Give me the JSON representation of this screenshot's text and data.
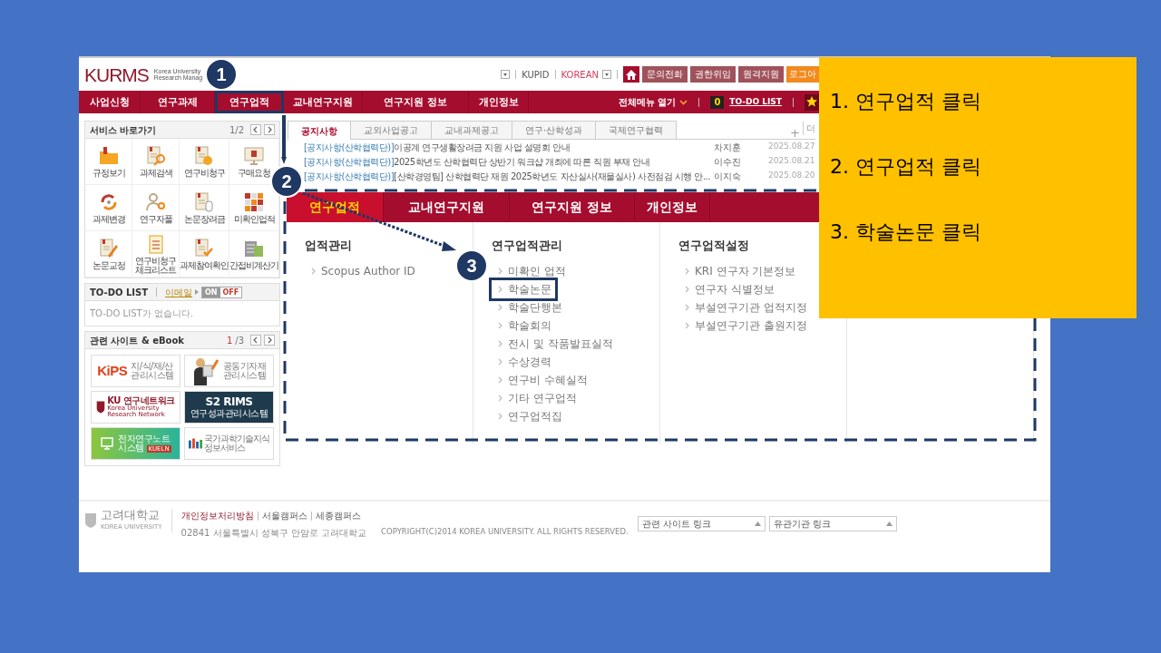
{
  "header": {
    "logo": "KURMS",
    "logo_subtitle": [
      "Korea University",
      "Research Manag"
    ],
    "links": [
      {
        "label": "KUPID",
        "emphasis": false
      },
      {
        "label": "KOREAN",
        "emphasis": true
      }
    ],
    "buttons": [
      {
        "label": "문의전화",
        "kind": "plain"
      },
      {
        "label": "권한위임",
        "kind": "plain"
      },
      {
        "label": "원격지원",
        "kind": "plain"
      },
      {
        "label": "로그아",
        "kind": "accent"
      }
    ]
  },
  "nav": {
    "items": [
      {
        "label": "사업신청",
        "selected": false,
        "annotated": false
      },
      {
        "label": "연구과제",
        "selected": false,
        "annotated": false
      },
      {
        "label": "연구업적",
        "selected": false,
        "annotated": true
      },
      {
        "label": "교내연구지원",
        "selected": false,
        "annotated": false
      },
      {
        "label": "연구지원 정보",
        "selected": false,
        "annotated": false
      },
      {
        "label": "개인정보",
        "selected": false,
        "annotated": false
      }
    ],
    "all_menu": "전체메뉴 열기",
    "todo_count": "0",
    "todo_label": "TO-DO LIST"
  },
  "shortcuts": {
    "title": "서비스 바로가기",
    "page": "1/2",
    "items": [
      "규정보기",
      "과제검색",
      "연구비청구",
      "구매요청",
      "과제변경",
      "연구자풀",
      "논문장려금",
      "미확인업적",
      "논문교정",
      "연구비청구 체크리스트",
      "과제참여확인",
      "간접비계산기"
    ]
  },
  "todo": {
    "title": "TO-DO LIST",
    "email": "이메일",
    "toggle": {
      "on_label": "ON",
      "off_label": "OFF",
      "on": false
    },
    "message": "TO-DO LIST가 없습니다."
  },
  "related": {
    "title": "관련 사이트 & eBook",
    "page": "1",
    "page_of": "/3",
    "banners": [
      {
        "kind": "kips",
        "logo": "KiPS",
        "lines": [
          "지/식/재/산",
          "관리시스템"
        ]
      },
      {
        "kind": "figure",
        "lines": [
          "공동기자재",
          "관리시스템"
        ]
      },
      {
        "kind": "crest",
        "logo": "KU 연구네트워크",
        "lines": [
          "Korea University Research Network"
        ]
      },
      {
        "kind": "dark",
        "logo": "S2 RIMS",
        "lines": [
          "연구성과관리시스템"
        ]
      },
      {
        "kind": "green",
        "lines": [
          "전자연구노트",
          "시스템"
        ],
        "tag": "KUELN"
      },
      {
        "kind": "bars",
        "lines": [
          "국가과학기술지식",
          "정보서비스"
        ]
      }
    ]
  },
  "notices": {
    "tabs": [
      {
        "label": "공지사항",
        "selected": true
      },
      {
        "label": "교외사업공고",
        "selected": false
      },
      {
        "label": "교내과제공고",
        "selected": false
      },
      {
        "label": "연구·산학성과",
        "selected": false
      },
      {
        "label": "국제연구협력",
        "selected": false
      }
    ],
    "plus": "+",
    "more": "더",
    "rows": [
      {
        "category": "[공지사항(산학협력단)]",
        "title": "이공계 연구생활장려금 지원 사업 설명회 안내",
        "author": "차지훈",
        "date": "2025.08.27"
      },
      {
        "category": "[공지사항(산학협력단)]",
        "title": "2025학년도 산학협력단 상반기 워크샵 개최에 따른 직원 부재 안내",
        "author": "이수진",
        "date": "2025.08.21"
      },
      {
        "category": "[공지사항(산학협력단)]",
        "title": "[산학경영팀] 산학협력단 재원 2025학년도 자산실사(재물실사) 사전점검 시행 안...",
        "author": "이지숙",
        "date": "2025.08.20"
      }
    ]
  },
  "menu": {
    "tabs": [
      {
        "label": "연구업적",
        "selected": true
      },
      {
        "label": "교내연구지원",
        "selected": false
      },
      {
        "label": "연구지원 정보",
        "selected": false
      },
      {
        "label": "개인정보",
        "selected": false
      }
    ],
    "columns": [
      {
        "heading": "업적관리",
        "items": [
          {
            "label": "Scopus Author ID",
            "annotated": false
          }
        ]
      },
      {
        "heading": "연구업적관리",
        "items": [
          {
            "label": "미확인 업적",
            "annotated": false
          },
          {
            "label": "학술논문",
            "annotated": true
          },
          {
            "label": "학술단행본",
            "annotated": false
          },
          {
            "label": "학술회의",
            "annotated": false
          },
          {
            "label": "전시 및 작품발표실적",
            "annotated": false
          },
          {
            "label": "수상경력",
            "annotated": false
          },
          {
            "label": "연구비 수혜실적",
            "annotated": false
          },
          {
            "label": "기타 연구업적",
            "annotated": false
          },
          {
            "label": "연구업적집",
            "annotated": false
          }
        ]
      },
      {
        "heading": "연구업적설정",
        "items": [
          {
            "label": "KRI 연구자 기본정보",
            "annotated": false
          },
          {
            "label": "연구자 식별정보",
            "annotated": false
          },
          {
            "label": "부설연구기관 업적지정",
            "annotated": false
          },
          {
            "label": "부설연구기관 출원지정",
            "annotated": false
          }
        ]
      }
    ]
  },
  "footer": {
    "logo": "고려대학교",
    "logo_sub": "KOREA UNIVERSITY",
    "links": [
      {
        "label": "개인정보처리방침",
        "emphasis": true
      },
      {
        "label": "서울캠퍼스",
        "emphasis": false
      },
      {
        "label": "세종캠퍼스",
        "emphasis": false
      }
    ],
    "address": "02841 서울특별시 성북구 안암로 고려대학교",
    "copyright": "COPYRIGHT(C)2014 KOREA UNIVERSITY. ALL RIGHTS RESERVED.",
    "selects": [
      "관련 사이트 링크",
      "유관기관 링크"
    ]
  },
  "markers": [
    "1",
    "2",
    "3"
  ],
  "callout": {
    "steps": [
      "1. 연구업적 클릭",
      "2. 연구업적 클릭",
      "3. 학술논문 클릭"
    ]
  }
}
